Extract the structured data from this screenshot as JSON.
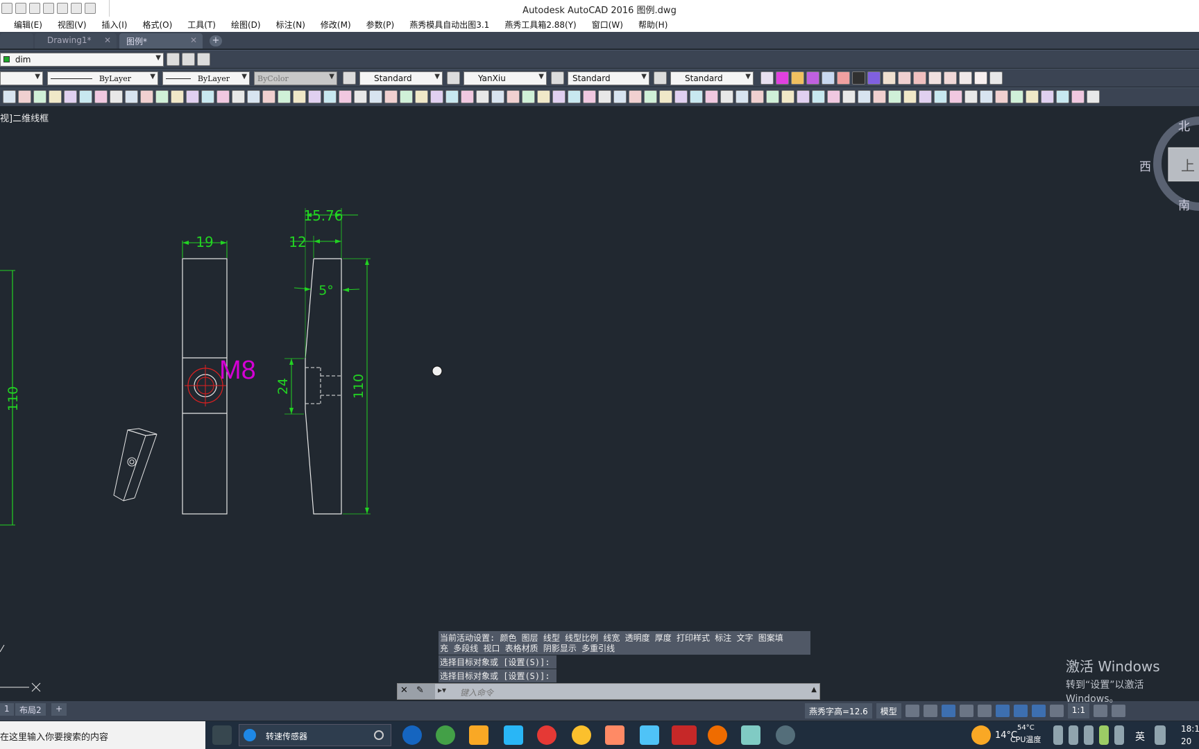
{
  "title": "Autodesk AutoCAD 2016     图例.dwg",
  "menus": [
    "编辑(E)",
    "视图(V)",
    "插入(I)",
    "格式(O)",
    "工具(T)",
    "绘图(D)",
    "标注(N)",
    "修改(M)",
    "参数(P)",
    "燕秀模具自动出图3.1",
    "燕秀工具箱2.88(Y)",
    "窗口(W)",
    "帮助(H)"
  ],
  "tabs": [
    {
      "label": "Drawing1*",
      "active": false
    },
    {
      "label": "图例*",
      "active": true
    }
  ],
  "layer": "dim",
  "linetype1": "ByLayer",
  "linetype2": "ByLayer",
  "color": "ByColor",
  "text_style": "Standard",
  "dim_style": "YanXiu",
  "table_style": "Standard",
  "mleader_style": "Standard",
  "view_label": "视]二维线框",
  "viewcube": {
    "north": "北",
    "west": "西",
    "south": "南",
    "face": "上"
  },
  "dims": {
    "d19": "19",
    "d1576": "15.76",
    "d12": "12",
    "d5deg": "5°",
    "d110_left": "110",
    "d24": "24",
    "d110_right": "110",
    "m8": "M8"
  },
  "command_history": [
    "当前活动设置:  颜色 图层 线型 线型比例 线宽 透明度 厚度 打印样式 标注 文字 图案填",
    "充 多段线 视口 表格材质 阴影显示 多重引线",
    "选择目标对象或 [设置(S)]:",
    "选择目标对象或 [设置(S)]:"
  ],
  "command_placeholder": "键入命令",
  "layout_tabs": [
    "1",
    "布局2"
  ],
  "status": {
    "text_height": "燕秀字高=12.6",
    "model": "模型",
    "scale": "1:1"
  },
  "activate_windows": {
    "line1": "激活 Windows",
    "line2": "转到“设置”以激活 Windows。"
  },
  "taskbar": {
    "search_text": "在这里输入你要搜索的内容",
    "app_label": "转速传感器",
    "weather": "14°C",
    "weather2": "54°C",
    "cpu": "CPU温度",
    "ime": "英",
    "time": "18:1",
    "date": "20"
  },
  "colors": {
    "dim": "#22d322",
    "magenta": "#d400d4",
    "red": "#e02020",
    "line": "#e8e8e8"
  }
}
